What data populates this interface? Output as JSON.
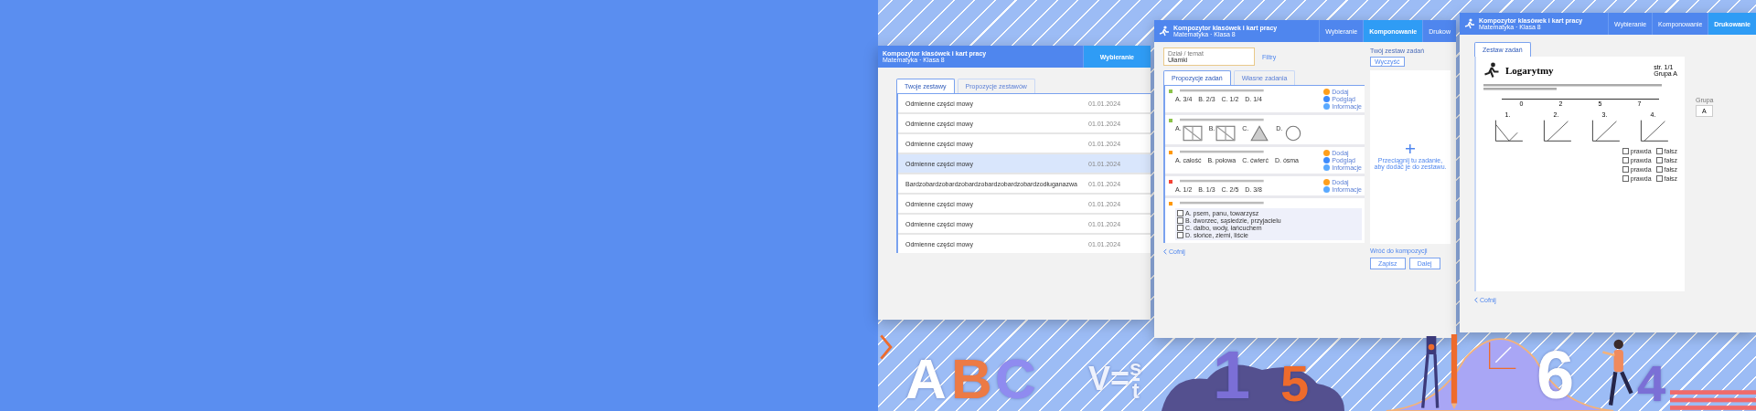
{
  "list_window": {
    "title": "Kompozytor klasówek i kart pracy",
    "subtitle": "Matematyka · Klasa 8",
    "step": "Wybieranie",
    "tabs": [
      {
        "label": "Twoje zestawy",
        "selected": true
      },
      {
        "label": "Propozycje zestawów",
        "selected": false
      }
    ],
    "rows": [
      {
        "name": "Odmienne części mowy",
        "date": "01.01.2024",
        "selected": false
      },
      {
        "name": "Odmienne części mowy",
        "date": "01.01.2024",
        "selected": false
      },
      {
        "name": "Odmienne części mowy",
        "date": "01.01.2024",
        "selected": false
      },
      {
        "name": "Odmienne części mowy",
        "date": "01.01.2024",
        "selected": true
      },
      {
        "name": "Bardzobardzobardzobardzobardzobardzobardzodługanazwa",
        "date": "01.01.2024",
        "selected": false
      },
      {
        "name": "Odmienne części mowy",
        "date": "01.01.2024",
        "selected": false
      },
      {
        "name": "Odmienne części mowy",
        "date": "01.01.2024",
        "selected": false
      },
      {
        "name": "Odmienne części mowy",
        "date": "01.01.2024",
        "selected": false
      }
    ]
  },
  "compose_window": {
    "title": "Kompozytor klasówek i kart pracy",
    "subtitle": "Matematyka · Klasa 8",
    "steps": [
      {
        "label": "Wybieranie",
        "selected": false
      },
      {
        "label": "Komponowanie",
        "selected": true
      },
      {
        "label": "Drukow",
        "selected": false
      }
    ],
    "topic_label": "Dział / temat",
    "topic_value": "Ułamki",
    "filter": "Filtry",
    "tabs": [
      {
        "label": "Propozycje zadań",
        "selected": true
      },
      {
        "label": "Własne zadania",
        "selected": false
      }
    ],
    "tasks": [
      {
        "kind": "choice",
        "color": "#8bc34a",
        "options": [
          "A. 3/4",
          "B. 2/3",
          "C. 1/2",
          "D. 1/4"
        ],
        "actions": [
          {
            "kind": "add",
            "label": "Dodaj"
          },
          {
            "kind": "preview",
            "label": "Podgląd"
          },
          {
            "kind": "info",
            "label": "Informacje"
          }
        ]
      },
      {
        "kind": "figures",
        "color": "#8bc34a",
        "options": [
          "A.",
          "B.",
          "C.",
          "D."
        ]
      },
      {
        "kind": "choice",
        "color": "#ff9800",
        "options": [
          "A. całość",
          "B. połowa",
          "C. ćwierć",
          "D. ósma"
        ],
        "actions": [
          {
            "kind": "add",
            "label": "Dodaj"
          },
          {
            "kind": "preview",
            "label": "Podgląd"
          },
          {
            "kind": "info",
            "label": "Informacje"
          }
        ]
      },
      {
        "kind": "choice",
        "color": "#f44336",
        "options": [
          "A. 1/2",
          "B. 1/3",
          "C. 2/5",
          "D. 3/8"
        ],
        "actions": [
          {
            "kind": "add",
            "label": "Dodaj"
          },
          {
            "kind": "info",
            "label": "Informacje"
          }
        ]
      },
      {
        "kind": "checklist",
        "color": "#ff9800",
        "options": [
          "A. psem, panu, towarzysz",
          "B. dworzec, sąsiedzie, przyjacielu",
          "C. dalbo, wody, łańcuchem",
          "D. słońce, ziemi, liście"
        ]
      }
    ],
    "set_title": "Twój zestaw zadań",
    "clear": "Wyczyść",
    "drop_hint": "Przeciągnij tu zadanie, aby dodać je do zestawu.",
    "footer_link": "Wróć do kompozycji",
    "buttons": [
      "Zapisz",
      "Dalej"
    ],
    "back": "Cofnij"
  },
  "print_window": {
    "title": "Kompozytor klasówek i kart pracy",
    "subtitle": "Matematyka · Klasa 8",
    "steps": [
      {
        "label": "Wybieranie",
        "selected": false
      },
      {
        "label": "Komponowanie",
        "selected": false
      },
      {
        "label": "Drukowanie",
        "selected": true
      }
    ],
    "tab": "Zestaw zadań",
    "doc_title": "Logarytmy",
    "page": "str. 1/1",
    "group": "Grupa A",
    "axis_ticks": [
      "0",
      "2",
      "5",
      "7"
    ],
    "graph_labels": [
      "1.",
      "2.",
      "3.",
      "4."
    ],
    "answers": [
      {
        "yes": "prawda",
        "no": "fałsz"
      },
      {
        "yes": "prawda",
        "no": "fałsz"
      },
      {
        "yes": "prawda",
        "no": "fałsz"
      },
      {
        "yes": "prawda",
        "no": "fałsz"
      }
    ],
    "side_label": "Grupa",
    "side_value": "A",
    "back": "Cofnij"
  },
  "decor": {
    "letters": [
      {
        "text": "A",
        "color": "#ffffff"
      },
      {
        "text": "B",
        "color": "#ec7a45"
      },
      {
        "text": "C",
        "color": "#8f8bf0"
      }
    ],
    "formula": {
      "lhs": "V=",
      "num": "s",
      "den": "t"
    },
    "digits": [
      {
        "text": "1",
        "color": "#7b6fd6"
      },
      {
        "text": "5",
        "color": "#ee6b2c"
      },
      {
        "text": "6",
        "color": "#ffffff"
      },
      {
        "text": "4",
        "color": "#7b6fd6"
      }
    ]
  }
}
